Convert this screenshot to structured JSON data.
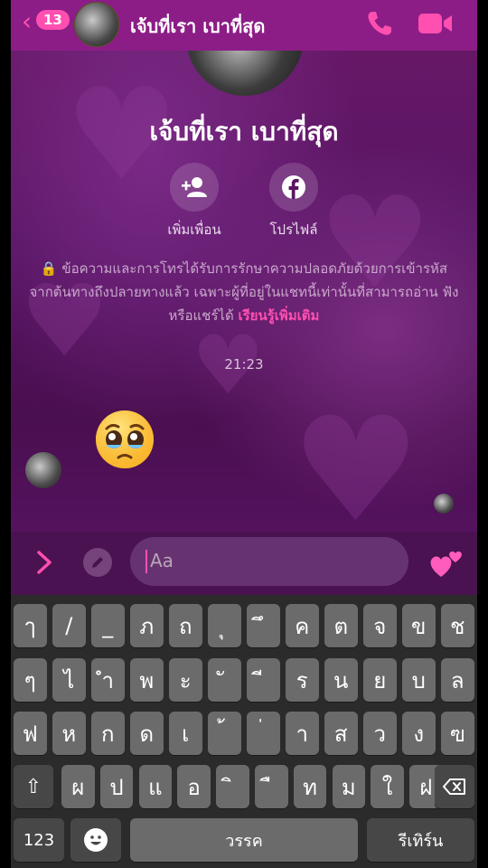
{
  "header": {
    "unread_count": "13",
    "contact_name": "เจ้บที่เรา เบาที่สุด"
  },
  "profile": {
    "name": "เจ้บที่เรา เบาที่สุด",
    "add_friend_label": "เพิ่มเพื่อน",
    "profile_label": "โปรไฟล์"
  },
  "notice": {
    "text": "ข้อความและการโทรได้รับการรักษาความปลอดภัยด้วยการเข้ารหัสจากต้นทางถึงปลายทางแล้ว เฉพาะผู้ที่อยู่ในแชทนี้เท่านั้นที่สามารถอ่าน ฟัง หรือแชร์ได้",
    "learn_more": "เรียนรู้เพิ่มเติม"
  },
  "conversation": {
    "time": "21:23",
    "message_emoji": "🥹"
  },
  "composer": {
    "placeholder": "Aa"
  },
  "keyboard": {
    "row1": [
      "ๅ",
      "/",
      "_",
      "ภ",
      "ถ",
      "ุ",
      "ึ",
      "ค",
      "ต",
      "จ",
      "ข",
      "ช"
    ],
    "row2": [
      "ๆ",
      "ไ",
      "ำ",
      "พ",
      "ะ",
      "ั",
      "ี",
      "ร",
      "น",
      "ย",
      "บ",
      "ล"
    ],
    "row3": [
      "ฟ",
      "ห",
      "ก",
      "ด",
      "เ",
      "้",
      "่",
      "า",
      "ส",
      "ว",
      "ง",
      "ฃ"
    ],
    "row4": [
      "ผ",
      "ป",
      "แ",
      "อ",
      "ิ",
      "ื",
      "ท",
      "ม",
      "ใ",
      "ฝ"
    ],
    "numbers_label": "123",
    "space_label": "วรรค",
    "return_label": "รีเทิร์น"
  },
  "colors": {
    "accent": "#ff4fb0",
    "header_bg": "#8c1d86",
    "keyboard_bg": "#2b2b2b",
    "key_bg": "#6b6b6b"
  }
}
